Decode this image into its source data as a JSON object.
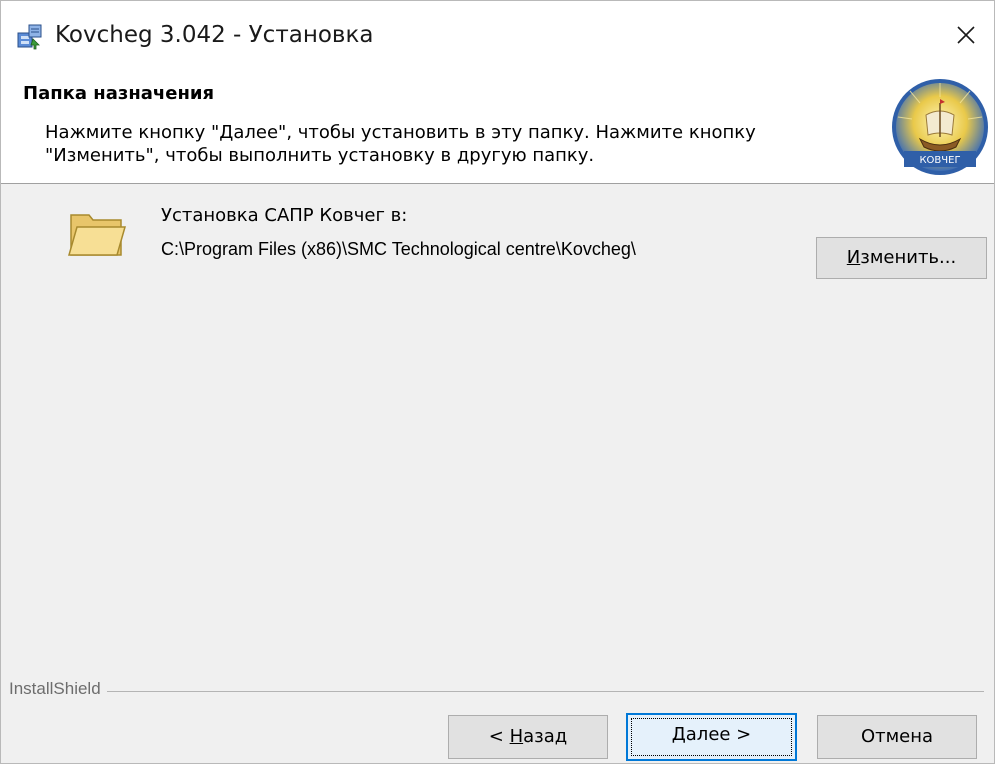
{
  "window": {
    "title": "Kovcheg 3.042 - Установка"
  },
  "banner": {
    "title": "Папка назначения",
    "description": "Нажмите кнопку \"Далее\", чтобы установить в эту папку. Нажмите кнопку \"Изменить\", чтобы выполнить установку в другую папку.",
    "logo_text": "КОВЧЕГ"
  },
  "main": {
    "install_label": "Установка САПР Ковчег в:",
    "install_path": "C:\\Program Files (x86)\\SMC Technological centre\\Kovcheg\\",
    "change_button": {
      "accel": "И",
      "rest": "зменить..."
    }
  },
  "footer": {
    "brand": "InstallShield",
    "back_button": {
      "prefix": "< ",
      "accel": "Н",
      "rest": "азад"
    },
    "next_button": {
      "accel": "Д",
      "rest": "алее >"
    },
    "cancel_button": "Отмена"
  },
  "colors": {
    "focus_border": "#0078d7",
    "button_bg": "#e1e1e1",
    "dialog_bg": "#f0f0f0"
  },
  "icons": {
    "app": "installer-icon",
    "close": "close-icon",
    "folder": "folder-icon",
    "logo": "kovcheg-logo"
  }
}
